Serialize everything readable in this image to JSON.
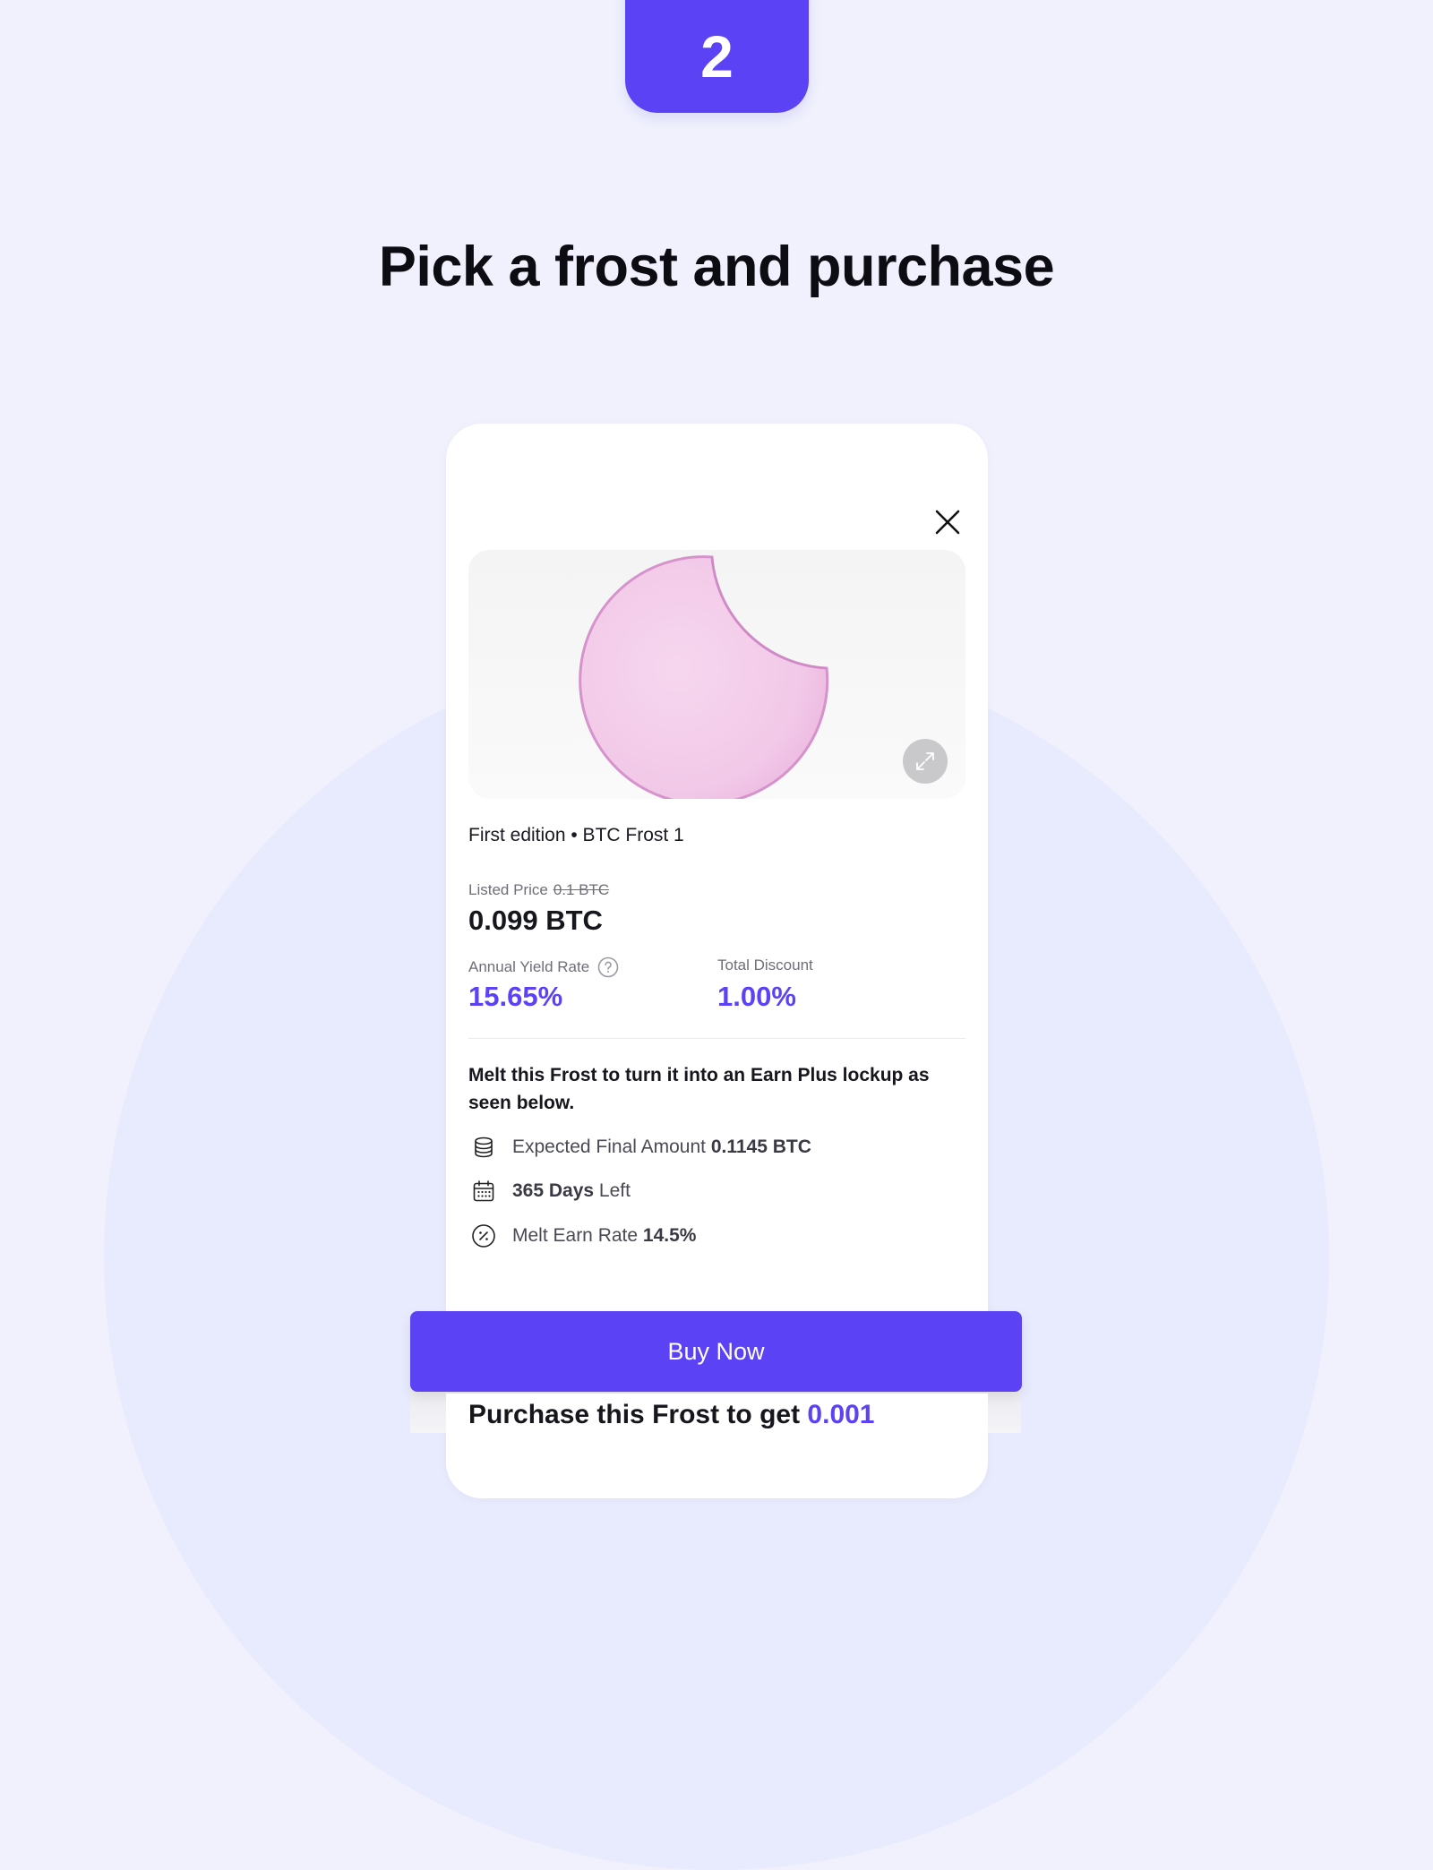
{
  "step": {
    "number": "2"
  },
  "headline": "Pick a frost and purchase",
  "colors": {
    "accent": "#5b43f5",
    "background": "#f0f1fd",
    "frost": "#f4cdea"
  },
  "card": {
    "close_icon": "close-icon",
    "expand_icon": "expand-icon",
    "edition": "First edition • BTC Frost 1",
    "listed_price_label": "Listed Price",
    "listed_price_original": "0.1 BTC",
    "price": "0.099 BTC",
    "annual_yield_label": "Annual Yield Rate",
    "annual_yield_value": "15.65%",
    "total_discount_label": "Total Discount",
    "total_discount_value": "1.00%",
    "melt_text": "Melt this Frost to turn it into an Earn Plus lockup as seen below.",
    "details": [
      {
        "icon": "coin-stack-icon",
        "label": "Expected Final Amount",
        "value": "0.1145 BTC"
      },
      {
        "icon": "calendar-icon",
        "value": "365 Days",
        "label": "Left"
      },
      {
        "icon": "percent-badge-icon",
        "label": "Melt Earn Rate",
        "value": "14.5%"
      }
    ]
  },
  "buy_button": "Buy Now",
  "purchase_text": {
    "prefix": "Purchase this Frost to get",
    "amount": "0.001"
  }
}
